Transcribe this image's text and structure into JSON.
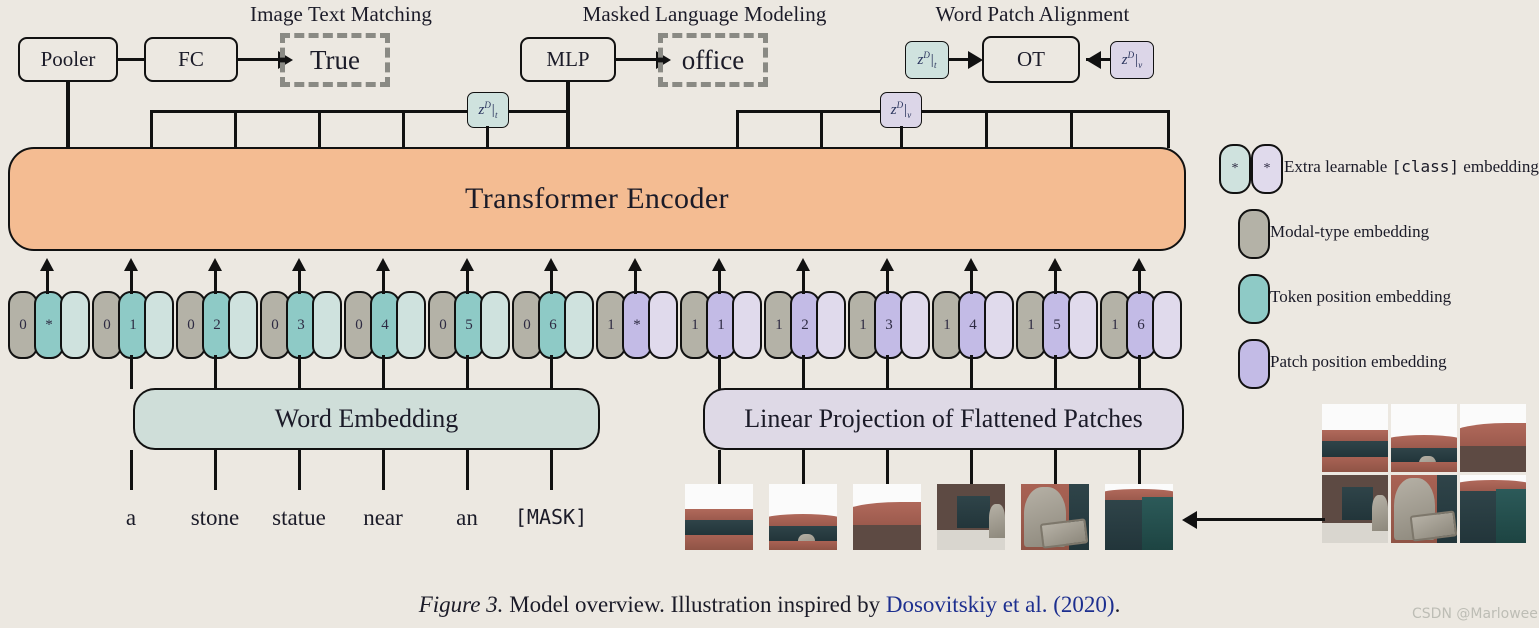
{
  "figure": {
    "caption_label": "Figure 3.",
    "caption_text": " Model overview. Illustration inspired by ",
    "caption_cite": "Dosovitskiy et al. (2020)",
    "caption_end": ".",
    "watermark": "CSDN @Marlowee"
  },
  "colors": {
    "background": "#ece8e1",
    "encoder": "#f4bc92",
    "word_embedding_box": "#cfded9",
    "patch_embedding_box": "#ded9e6",
    "modal_type_pill": "#b4b2a7",
    "token_position_pill": "#8ecac6",
    "token_embedding_pill": "#cfe2de",
    "patch_position_pill": "#c3bbe6",
    "patch_embedding_pill": "#e0daec",
    "citation_blue": "#1d2f8f",
    "dashed_border": "#8a8a84",
    "stroke": "#111111"
  },
  "tasks": [
    {
      "id": "itm",
      "title": "Image Text Matching",
      "output": "True"
    },
    {
      "id": "mlm",
      "title": "Masked Language Modeling",
      "output": "office"
    },
    {
      "id": "wpa",
      "title": "Word Patch Alignment",
      "output": ""
    }
  ],
  "heads": {
    "pooler": "Pooler",
    "fc": "FC",
    "mlp": "MLP",
    "ot": "OT"
  },
  "z_chips": {
    "text": {
      "base": "z",
      "sup": "D",
      "bar": "|",
      "sub": "t"
    },
    "vision": {
      "base": "z",
      "sup": "D",
      "bar": "|",
      "sub": "v"
    }
  },
  "encoder": {
    "label": "Transformer Encoder"
  },
  "embedding_modules": {
    "word": "Word Embedding",
    "patch": "Linear Projection of Flattened Patches"
  },
  "text_tokens": {
    "modal_type": "0",
    "positions": [
      "*",
      "1",
      "2",
      "3",
      "4",
      "5",
      "6"
    ],
    "words": [
      "a",
      "stone",
      "statue",
      "near",
      "an",
      "[MASK]"
    ]
  },
  "image_tokens": {
    "modal_type": "1",
    "positions": [
      "*",
      "1",
      "2",
      "3",
      "4",
      "5",
      "6"
    ]
  },
  "legend": {
    "items": [
      {
        "id": "class",
        "label_pre": "Extra learnable ",
        "label_mono": "[class]",
        "label_post": " embedding",
        "swatches": [
          "token-class",
          "patch-class"
        ],
        "marker": "*"
      },
      {
        "id": "modal",
        "label_pre": "Modal-type embedding",
        "label_mono": "",
        "label_post": "",
        "swatches": [
          "modal"
        ],
        "marker": ""
      },
      {
        "id": "tokenpos",
        "label_pre": "Token position embedding",
        "label_mono": "",
        "label_post": "",
        "swatches": [
          "tokpos"
        ],
        "marker": ""
      },
      {
        "id": "patchpos",
        "label_pre": "Patch position embedding",
        "label_mono": "",
        "label_post": "",
        "swatches": [
          "patchpos"
        ],
        "marker": ""
      }
    ]
  },
  "source_image": {
    "description": "photo of a stone statue in front of a brick building, split into a 3x2 patch grid",
    "grid_cols": 3,
    "grid_rows": 2,
    "patch_count": 6
  }
}
